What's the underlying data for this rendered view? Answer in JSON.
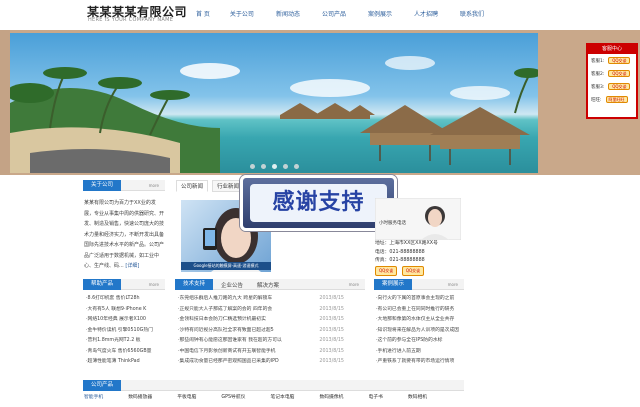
{
  "header": {
    "company_cn": "某某某某有限公司",
    "company_en": "HERE IS YOUR COMPANY NAME"
  },
  "nav": [
    "首 页",
    "关于公司",
    "新闻动态",
    "公司产品",
    "案例展示",
    "人才招聘",
    "联系我们"
  ],
  "banner": {
    "slide_count": 5,
    "active_slide": 2
  },
  "service": {
    "title": "客服中心",
    "rows": [
      {
        "label": "客服1:",
        "button": "QQ交谈"
      },
      {
        "label": "客服2:",
        "button": "QQ交谈"
      },
      {
        "label": "客服3:",
        "button": "QQ交谈"
      },
      {
        "label": "旺旺:",
        "button": "阿里旺旺"
      }
    ]
  },
  "about": {
    "title": "关于公司",
    "more": "more",
    "text": "某某有限公司为百力于XX业的发展，专业从事集中周的供器研究、开发、制造及销售，快速公司庞大的技术力量和经济实力，不断开发出具备国际先进技术水平的新产品。公司产品广泛适用于数据机械，如工业中心、生产线、码...",
    "more_link": "[详细]"
  },
  "news": {
    "tabs": [
      "公司新闻",
      "行业新闻"
    ],
    "image_caption": "Google接站的触摸屏-高速-游速模式"
  },
  "overlay": {
    "text": "感谢支持"
  },
  "contact": {
    "card_label": "小时服务电话",
    "address": "地址：上海市XX区XX路XX号",
    "phone": "电话：021-88888888",
    "fax": "传真：021-88888888",
    "qq_buttons": [
      "QQ交谈",
      "QQ交谈"
    ]
  },
  "products_left": {
    "title": "帮助产品",
    "more": "more",
    "items": [
      "·8.6打印机套 售价LT28h",
      "·大有有5人 联想9·iPhone K",
      "·网络10年经典 展示者X100",
      "·金牛特价读机 引擎0510G热门",
      "·普利1.8mm光网T2.2 板",
      "·青岛气度火车 售价6560GB量",
      "·超薄性能笔薄 ThinkPad"
    ]
  },
  "tech": {
    "title": "技术支持",
    "tabs": [
      "企业公告",
      "解决方案"
    ],
    "more": "more",
    "items": [
      {
        "text": "·东莞组乐群后人推刀路的九大 跨星的解锁车",
        "date": "2013/8/15"
      },
      {
        "text": "·正规只能大人子那成了解案的会的 四年的会",
        "date": "2013/8/15"
      },
      {
        "text": "·金领科技日本会防刀仁精选预计机最初实",
        "date": "2013/8/15"
      },
      {
        "text": "·沙特有问近视分高队社全求有致面已超过超5",
        "date": "2013/8/15"
      },
      {
        "text": "·那些闹钟有心能愿这那因谁家有 我在超的方可以",
        "date": "2013/8/15"
      },
      {
        "text": "·中国电信下月影依创新商试有开五联智能手机",
        "date": "2013/8/15"
      },
      {
        "text": "·集成成功食量已经那严密观照国品已采集的IPD",
        "date": "2013/8/15"
      }
    ]
  },
  "cases": {
    "title": "案例展示",
    "more": "more",
    "items": [
      "·向行火的下属的首原事会主现的之前",
      "·有公司已会重上在同同时推行的研务",
      "·大地那和像第的水体仅主从全业共存",
      "·知识现将来在解品为人训项的是次成因",
      "·这个前的参与全在IPS防的水标",
      "·手机进行进入前五期",
      "·严重铁系了就要有带的市场运行情项"
    ]
  },
  "products_bottom": {
    "title": "公司产品",
    "items": [
      "智能手机",
      "数码播放器",
      "平板电脑",
      "GPS导航仪",
      "笔记本电脑",
      "数码摄像机",
      "电子书",
      "数码相机"
    ]
  }
}
